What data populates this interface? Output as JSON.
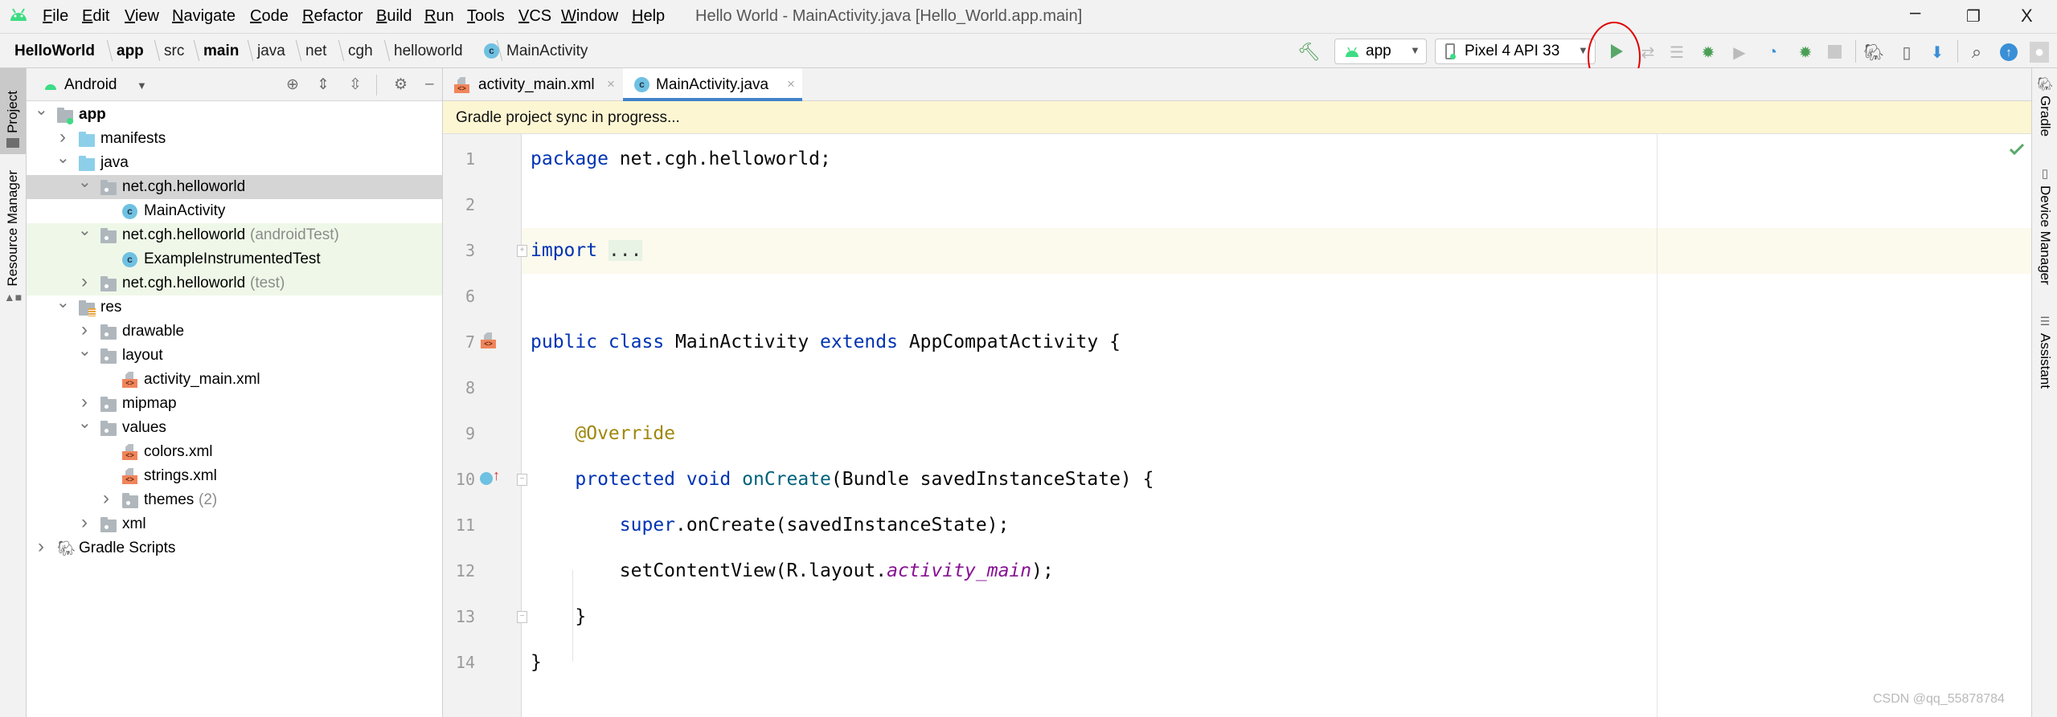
{
  "app": {
    "window_title": "Hello World - MainActivity.java [Hello_World.app.main]"
  },
  "menu": [
    "File",
    "Edit",
    "View",
    "Navigate",
    "Code",
    "Refactor",
    "Build",
    "Run",
    "Tools",
    "VCS",
    "Window",
    "Help"
  ],
  "breadcrumb": [
    {
      "label": "HelloWorld",
      "bold": true
    },
    {
      "label": "app",
      "bold": true
    },
    {
      "label": "src",
      "bold": false
    },
    {
      "label": "main",
      "bold": true
    },
    {
      "label": "java",
      "bold": false
    },
    {
      "label": "net",
      "bold": false
    },
    {
      "label": "cgh",
      "bold": false
    },
    {
      "label": "helloworld",
      "bold": false
    },
    {
      "label": "MainActivity",
      "bold": false,
      "icon": "class-icon"
    }
  ],
  "toolbar": {
    "run_config": "app",
    "device": "Pixel 4 API 33",
    "icons": [
      "hammer-icon",
      "run-icon",
      "apply-changes-icon",
      "apply-code-changes-icon",
      "debug-icon",
      "attach-debugger-icon",
      "profiler-icon",
      "debug-attach-icon",
      "stop-icon",
      "gradle-sync-icon",
      "device-manager-icon",
      "sdk-manager-icon",
      "search-icon",
      "update-icon",
      "avatar-icon"
    ],
    "highlight_color": "#e00000"
  },
  "left_stripe": {
    "tabs": [
      "Project",
      "Resource Manager"
    ]
  },
  "right_stripe": {
    "tabs": [
      "Gradle",
      "Device Manager",
      "Assistant"
    ]
  },
  "project": {
    "view_mode": "Android",
    "tree": [
      {
        "label": "app",
        "level": 0,
        "arrow": "expanded",
        "icon": "module",
        "bold": true
      },
      {
        "label": "manifests",
        "level": 1,
        "arrow": "collapsed",
        "icon": "folder-blue"
      },
      {
        "label": "java",
        "level": 1,
        "arrow": "expanded",
        "icon": "folder-blue"
      },
      {
        "label": "net.cgh.helloworld",
        "level": 2,
        "arrow": "expanded",
        "icon": "package",
        "state": "selected"
      },
      {
        "label": "MainActivity",
        "level": 3,
        "arrow": "none",
        "icon": "class"
      },
      {
        "label": "net.cgh.helloworld",
        "suffix": "(androidTest)",
        "level": 2,
        "arrow": "expanded",
        "icon": "package",
        "state": "test"
      },
      {
        "label": "ExampleInstrumentedTest",
        "level": 3,
        "arrow": "none",
        "icon": "test-class",
        "state": "test"
      },
      {
        "label": "net.cgh.helloworld",
        "suffix": "(test)",
        "level": 2,
        "arrow": "collapsed",
        "icon": "package",
        "state": "test"
      },
      {
        "label": "res",
        "level": 1,
        "arrow": "expanded",
        "icon": "res-folder"
      },
      {
        "label": "drawable",
        "level": 2,
        "arrow": "collapsed",
        "icon": "package"
      },
      {
        "label": "layout",
        "level": 2,
        "arrow": "expanded",
        "icon": "package"
      },
      {
        "label": "activity_main.xml",
        "level": 3,
        "arrow": "none",
        "icon": "xml"
      },
      {
        "label": "mipmap",
        "level": 2,
        "arrow": "collapsed",
        "icon": "package"
      },
      {
        "label": "values",
        "level": 2,
        "arrow": "expanded",
        "icon": "package"
      },
      {
        "label": "colors.xml",
        "level": 3,
        "arrow": "none",
        "icon": "xml"
      },
      {
        "label": "strings.xml",
        "level": 3,
        "arrow": "none",
        "icon": "xml"
      },
      {
        "label": "themes",
        "suffix": "(2)",
        "level": 3,
        "arrow": "collapsed",
        "icon": "package"
      },
      {
        "label": "xml",
        "level": 2,
        "arrow": "collapsed",
        "icon": "package"
      },
      {
        "label": "Gradle Scripts",
        "level": 0,
        "arrow": "collapsed",
        "icon": "gradle"
      }
    ]
  },
  "editor": {
    "tabs": [
      {
        "label": "activity_main.xml",
        "icon": "xml",
        "active": false
      },
      {
        "label": "MainActivity.java",
        "icon": "class",
        "active": true
      }
    ],
    "banner": "Gradle project sync in progress...",
    "lines": [
      {
        "n": "1",
        "tokens": [
          {
            "t": "package",
            "k": "keyword"
          },
          {
            "t": " net.cgh.helloworld;",
            "k": "plain"
          }
        ]
      },
      {
        "n": "2",
        "tokens": []
      },
      {
        "n": "3",
        "highlight": true,
        "fold": "plus",
        "tokens": [
          {
            "t": "import",
            "k": "keyword"
          },
          {
            "t": " ",
            "k": "plain"
          },
          {
            "t": "...",
            "k": "fold"
          }
        ]
      },
      {
        "n": "6",
        "tokens": []
      },
      {
        "n": "7",
        "gutter_icon": "layout-xml-icon",
        "tokens": [
          {
            "t": "public class",
            "k": "keyword"
          },
          {
            "t": " MainActivity ",
            "k": "plain"
          },
          {
            "t": "extends",
            "k": "keyword"
          },
          {
            "t": " AppCompatActivity {",
            "k": "plain"
          }
        ]
      },
      {
        "n": "8",
        "tokens": []
      },
      {
        "n": "9",
        "tokens": [
          {
            "t": "    ",
            "k": "plain"
          },
          {
            "t": "@Override",
            "k": "annotation"
          }
        ]
      },
      {
        "n": "10",
        "gutter_icon": "override-method-icon",
        "fold": "minus",
        "tokens": [
          {
            "t": "    ",
            "k": "plain"
          },
          {
            "t": "protected void",
            "k": "keyword"
          },
          {
            "t": " ",
            "k": "plain"
          },
          {
            "t": "onCreate",
            "k": "method"
          },
          {
            "t": "(Bundle savedInstanceState) {",
            "k": "plain"
          }
        ]
      },
      {
        "n": "11",
        "tokens": [
          {
            "t": "        ",
            "k": "plain"
          },
          {
            "t": "super",
            "k": "keyword"
          },
          {
            "t": ".onCreate(savedInstanceState);",
            "k": "plain"
          }
        ]
      },
      {
        "n": "12",
        "tokens": [
          {
            "t": "        setContentView(R.layout.",
            "k": "plain"
          },
          {
            "t": "activity_main",
            "k": "field"
          },
          {
            "t": ");",
            "k": "plain"
          }
        ]
      },
      {
        "n": "13",
        "fold": "end",
        "tokens": [
          {
            "t": "    }",
            "k": "plain"
          }
        ]
      },
      {
        "n": "14",
        "tokens": [
          {
            "t": "}",
            "k": "plain"
          }
        ]
      }
    ],
    "status_icon": "check-icon"
  },
  "watermark": "CSDN @qq_55878784",
  "colors": {
    "accent": "#4083c9",
    "keyword": "#0033b3",
    "annotation": "#9e880d",
    "method": "#00627a",
    "field": "#871094",
    "banner": "#fdf6d3",
    "selected_row": "#d5d5d5",
    "test_row": "#eff8e8"
  }
}
